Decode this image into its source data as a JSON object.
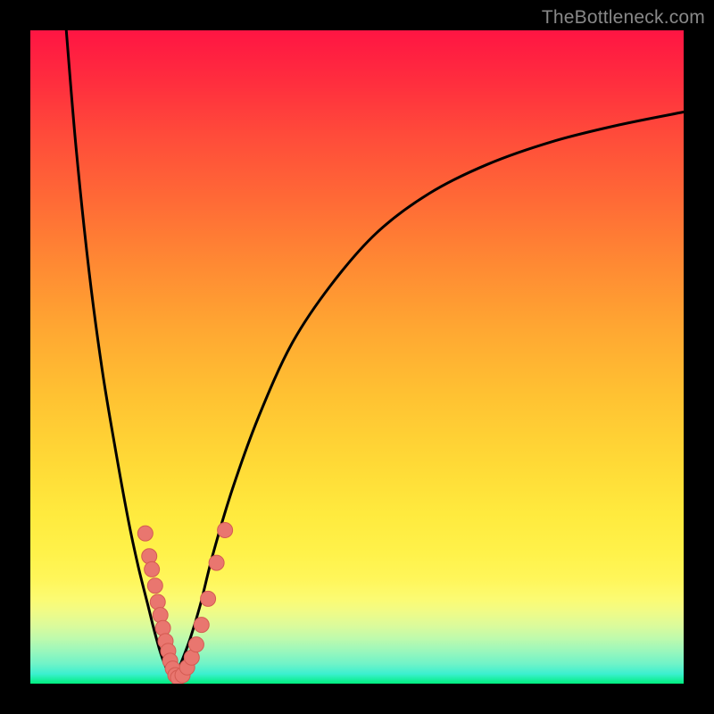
{
  "watermark": "TheBottleneck.com",
  "colors": {
    "frame": "#000000",
    "curve": "#000000",
    "marker_fill": "#e9766f",
    "marker_stroke": "#d45b52"
  },
  "chart_data": {
    "type": "line",
    "title": "",
    "xlabel": "",
    "ylabel": "",
    "xlim": [
      0,
      100
    ],
    "ylim": [
      0,
      100
    ],
    "grid": false,
    "legend": false,
    "note": "No axis ticks or numeric labels are present in the image; x and y are normalized to the visible plot area (0–100).",
    "series": [
      {
        "name": "left-branch",
        "x": [
          5.5,
          7,
          9,
          11,
          13,
          15,
          16.5,
          18,
          19,
          20,
          21,
          22
        ],
        "y": [
          100,
          82,
          63,
          48,
          36,
          25,
          18,
          12,
          8,
          4.5,
          2,
          0.7
        ]
      },
      {
        "name": "right-branch",
        "x": [
          22,
          23,
          24.5,
          26,
          28,
          31,
          35,
          40,
          46,
          53,
          61,
          70,
          80,
          90,
          100
        ],
        "y": [
          0.7,
          3,
          7,
          12,
          20,
          30,
          41,
          52,
          61,
          69,
          75,
          79.5,
          83,
          85.5,
          87.5
        ]
      }
    ],
    "markers": {
      "name": "data-points",
      "points": [
        {
          "x": 17.6,
          "y": 23.0
        },
        {
          "x": 18.2,
          "y": 19.5
        },
        {
          "x": 18.6,
          "y": 17.5
        },
        {
          "x": 19.1,
          "y": 15.0
        },
        {
          "x": 19.5,
          "y": 12.5
        },
        {
          "x": 19.9,
          "y": 10.5
        },
        {
          "x": 20.3,
          "y": 8.5
        },
        {
          "x": 20.7,
          "y": 6.5
        },
        {
          "x": 21.1,
          "y": 5.0
        },
        {
          "x": 21.4,
          "y": 3.5
        },
        {
          "x": 21.8,
          "y": 2.3
        },
        {
          "x": 22.2,
          "y": 1.3
        },
        {
          "x": 22.6,
          "y": 0.9
        },
        {
          "x": 23.3,
          "y": 1.3
        },
        {
          "x": 24.0,
          "y": 2.5
        },
        {
          "x": 24.7,
          "y": 4.0
        },
        {
          "x": 25.4,
          "y": 6.0
        },
        {
          "x": 26.2,
          "y": 9.0
        },
        {
          "x": 27.2,
          "y": 13.0
        },
        {
          "x": 28.5,
          "y": 18.5
        },
        {
          "x": 29.8,
          "y": 23.5
        }
      ]
    }
  }
}
